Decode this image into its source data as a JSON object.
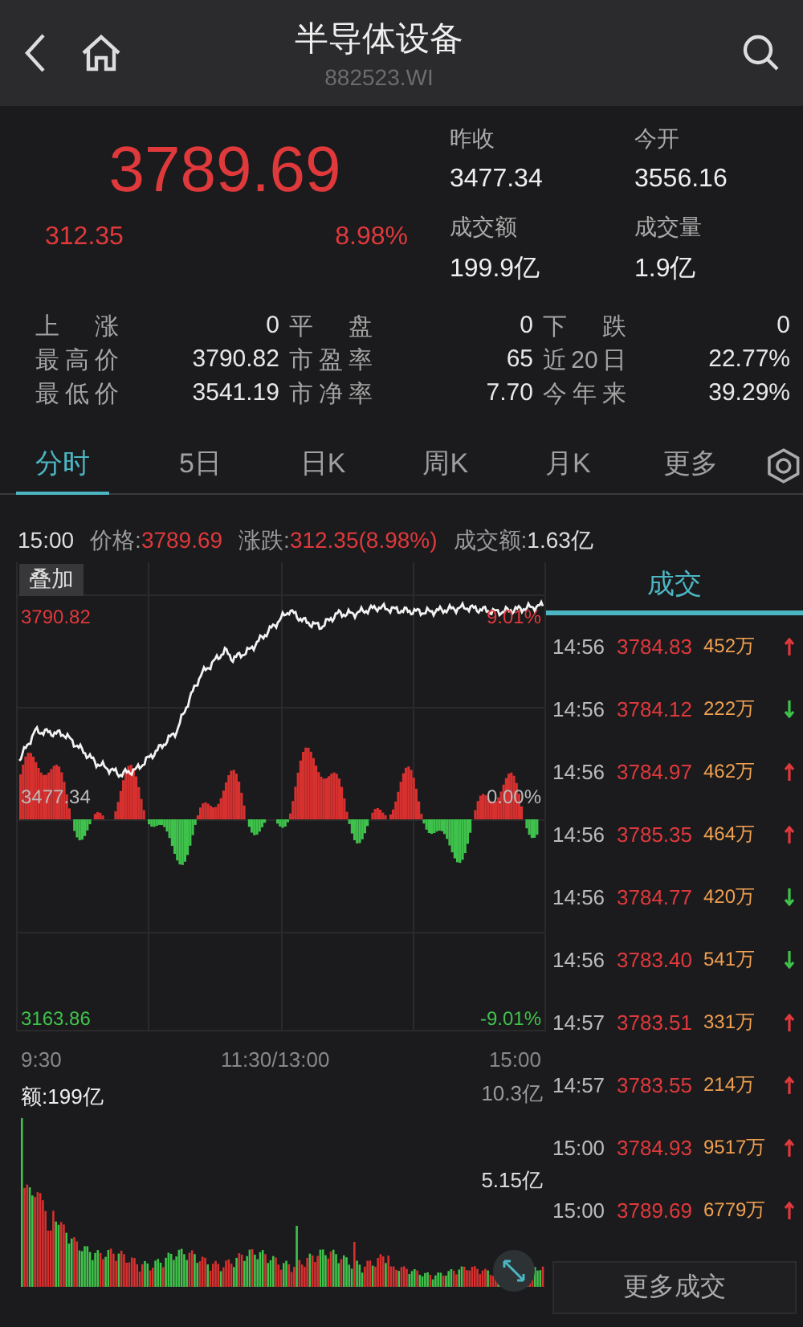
{
  "header": {
    "title": "半导体设备",
    "code": "882523.WI"
  },
  "quote": {
    "price": "3789.69",
    "change": "312.35",
    "change_pct": "8.98%",
    "stats": [
      {
        "label": "昨收",
        "value": "3477.34"
      },
      {
        "label": "今开",
        "value": "3556.16"
      },
      {
        "label": "成交额",
        "value": "199.9亿"
      },
      {
        "label": "成交量",
        "value": "1.9亿"
      }
    ]
  },
  "summary": [
    [
      {
        "label": "上涨",
        "value": "0"
      },
      {
        "label": "平盘",
        "value": "0"
      },
      {
        "label": "下跌",
        "value": "0"
      }
    ],
    [
      {
        "label": "最高价",
        "value": "3790.82"
      },
      {
        "label": "市盈率",
        "value": "65"
      },
      {
        "label": "近20日",
        "value": "22.77%"
      }
    ],
    [
      {
        "label": "最低价",
        "value": "3541.19"
      },
      {
        "label": "市净率",
        "value": "7.70"
      },
      {
        "label": "今年来",
        "value": "39.29%"
      }
    ]
  ],
  "tabs": [
    {
      "label": "分时",
      "selected": true
    },
    {
      "label": "5日",
      "selected": false
    },
    {
      "label": "日K",
      "selected": false
    },
    {
      "label": "周K",
      "selected": false
    },
    {
      "label": "月K",
      "selected": false
    },
    {
      "label": "更多",
      "selected": false
    }
  ],
  "info_bar": {
    "time": "15:00",
    "items": [
      {
        "label": "价格:",
        "value": "3789.69",
        "kind": "up"
      },
      {
        "label": "涨跌:",
        "value": "312.35(8.98%)",
        "kind": "up"
      },
      {
        "label": "成交额:",
        "value": "1.63亿",
        "kind": "plain"
      }
    ]
  },
  "chart": {
    "overlay_button": "叠加",
    "high": "3790.82",
    "high_pct": "9.01%",
    "base": "3477.34",
    "base_pct": "0.00%",
    "low": "3163.86",
    "low_pct": "-9.01%",
    "times": [
      "9:30",
      "11:30/13:00",
      "15:00"
    ]
  },
  "volume": {
    "label": "额:199亿",
    "top": "10.3亿",
    "mid": "5.15亿"
  },
  "trades": {
    "title": "成交",
    "selected": true,
    "more": "更多成交",
    "rows": [
      {
        "time": "14:56",
        "price": "3784.83",
        "volume": "452万",
        "up": true
      },
      {
        "time": "14:56",
        "price": "3784.12",
        "volume": "222万",
        "up": false
      },
      {
        "time": "14:56",
        "price": "3784.97",
        "volume": "462万",
        "up": true
      },
      {
        "time": "14:56",
        "price": "3785.35",
        "volume": "464万",
        "up": true
      },
      {
        "time": "14:56",
        "price": "3784.77",
        "volume": "420万",
        "up": false
      },
      {
        "time": "14:56",
        "price": "3783.40",
        "volume": "541万",
        "up": false
      },
      {
        "time": "14:57",
        "price": "3783.51",
        "volume": "331万",
        "up": true
      },
      {
        "time": "14:57",
        "price": "3783.55",
        "volume": "214万",
        "up": true
      },
      {
        "time": "15:00",
        "price": "3784.93",
        "volume": "9517万",
        "up": true
      },
      {
        "time": "15:00",
        "price": "3789.69",
        "volume": "6779万",
        "up": true
      }
    ]
  }
}
